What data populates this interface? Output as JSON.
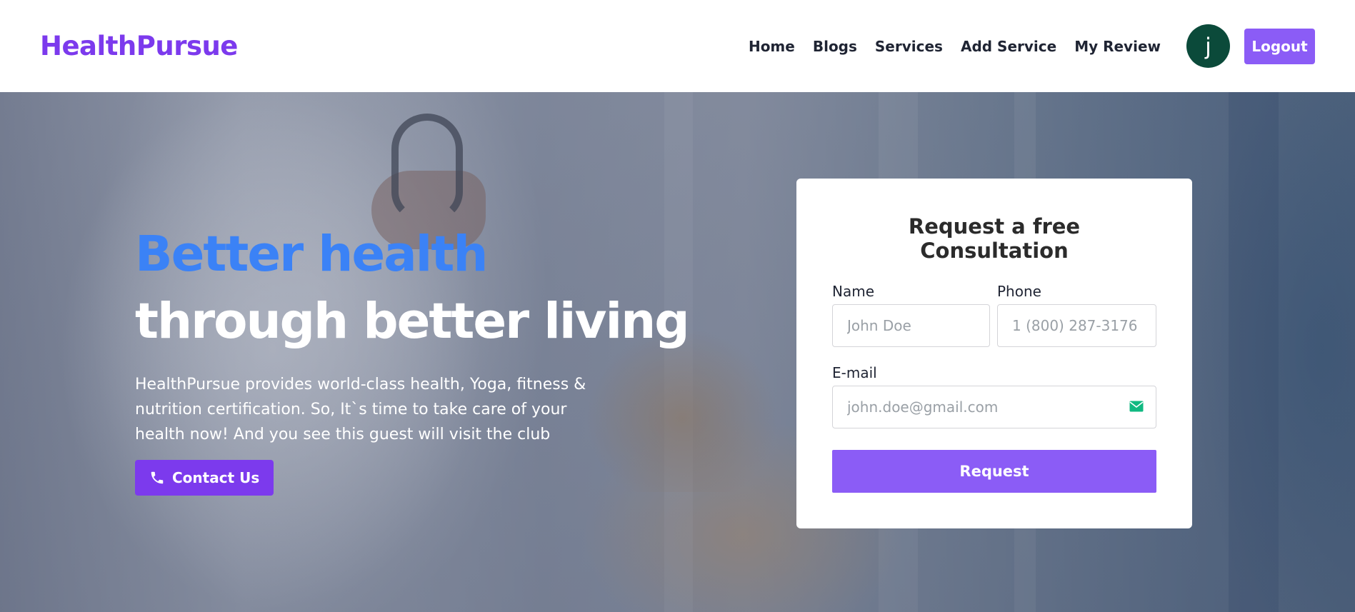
{
  "brand": {
    "name": "HealthPursue",
    "color": "#7c3aed"
  },
  "nav": {
    "items": [
      {
        "label": "Home"
      },
      {
        "label": "Blogs"
      },
      {
        "label": "Services"
      },
      {
        "label": "Add Service"
      },
      {
        "label": "My Review"
      }
    ],
    "avatar_letter": "j",
    "avatar_color": "#0b4a3a",
    "logout_label": "Logout"
  },
  "hero": {
    "title_line1": "Better health",
    "title_line2": "through better living",
    "description": "HealthPursue provides world-class health, Yoga, fitness & nutrition certification. So, It`s time to take care of your health now! And you see this guest will visit the club",
    "contact_label": "Contact Us",
    "contact_icon": "phone-icon",
    "accent_color": "#3b82f6"
  },
  "consultation": {
    "title": "Request a free Consultation",
    "name_label": "Name",
    "name_placeholder": "John Doe",
    "phone_label": "Phone",
    "phone_placeholder": "1 (800) 287-3176",
    "email_label": "E-mail",
    "email_placeholder": "john.doe@gmail.com",
    "email_icon": "mail-icon",
    "request_label": "Request",
    "button_color": "#8b5cf6"
  }
}
